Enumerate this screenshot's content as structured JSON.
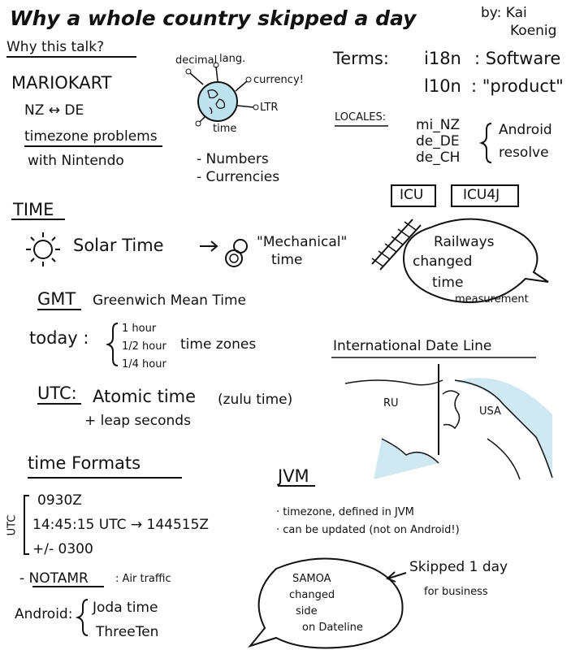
{
  "title": "Why a whole country skipped a day",
  "author": {
    "by": "by: Kai",
    "name": "Koenig"
  },
  "why": {
    "heading": "Why this talk?",
    "mariokart": "MARIOKART",
    "nz_de": "NZ ↔ DE",
    "tz_problems": "timezone problems",
    "with_nintendo": "with Nintendo"
  },
  "globe": {
    "labels": [
      "decimal",
      "lang.",
      "currency!",
      "LTR",
      "time"
    ]
  },
  "numbers": "- Numbers",
  "currencies": "- Currencies",
  "terms": {
    "heading": "Terms:",
    "i18n_key": "i18n",
    "i18n_val": ": Software",
    "l10n_key": "l10n",
    "l10n_val": ": \"product\""
  },
  "locales": {
    "heading": "LOCALES:",
    "items": [
      "mi_NZ",
      "de_DE",
      "de_CH"
    ],
    "note_line1": "Android",
    "note_line2": "resolve"
  },
  "icu": {
    "a": "ICU",
    "b": "ICU4J"
  },
  "time_section": {
    "heading": "TIME",
    "solar": "Solar Time",
    "mechanical_line1": "\"Mechanical\"",
    "mechanical_line2": "time",
    "railways": [
      "Railways",
      "changed",
      "time",
      "measurement"
    ]
  },
  "gmt": {
    "abbr": "GMT",
    "full": "Greenwich Mean Time"
  },
  "today": {
    "label": "today :",
    "options": [
      "1 hour",
      "1/2 hour",
      "1/4 hour"
    ],
    "tz": "time zones"
  },
  "idl": {
    "heading": "International Date Line",
    "ru": "RU",
    "usa": "USA"
  },
  "utc": {
    "abbr": "UTC:",
    "atomic": "Atomic time",
    "zulu": "(zulu time)",
    "leap": "+ leap seconds"
  },
  "formats": {
    "heading": "time Formats",
    "side": "UTC",
    "items": [
      "0930Z",
      "14:45:15 UTC → 144515Z",
      "+/- 0300"
    ]
  },
  "jvm": {
    "heading": "JVM",
    "items": [
      "· timezone, defined in JVM",
      "· can be updated (not on Android!)"
    ]
  },
  "notam": {
    "abbr": "- NOTAMR",
    "desc": ": Air traffic"
  },
  "android": {
    "label": "Android:",
    "items": [
      "Joda time",
      "ThreeTen"
    ]
  },
  "samoa": {
    "lines": [
      "SAMOA",
      "changed",
      "side",
      "on Dateline"
    ],
    "note_line1": "Skipped 1 day",
    "note_line2": "for business"
  }
}
